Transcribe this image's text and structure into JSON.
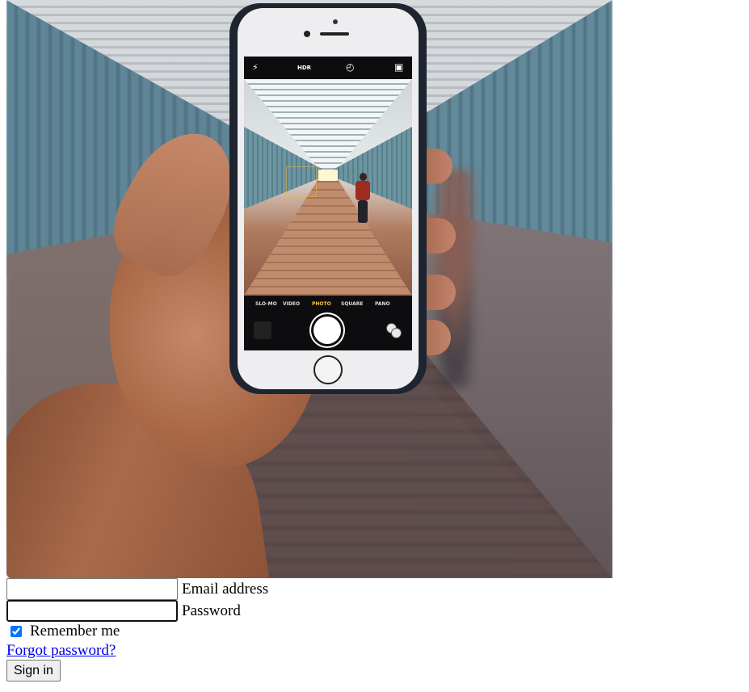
{
  "hero_image": {
    "alt": "Hand holding a smartphone taking a photo in a corridor",
    "camera_app": {
      "top_bar": [
        "HDR"
      ],
      "modes": [
        "SLO-MO",
        "VIDEO",
        "PHOTO",
        "SQUARE",
        "PANO"
      ],
      "active_mode": "PHOTO"
    }
  },
  "form": {
    "email": {
      "label": "Email address",
      "value": ""
    },
    "password": {
      "label": "Password",
      "value": ""
    },
    "remember": {
      "label": "Remember me",
      "checked": true
    },
    "forgot_link": "Forgot password?",
    "submit_label": "Sign in"
  },
  "colors": {
    "link": "#0000ee",
    "checkbox_accent": "#0075ff"
  }
}
